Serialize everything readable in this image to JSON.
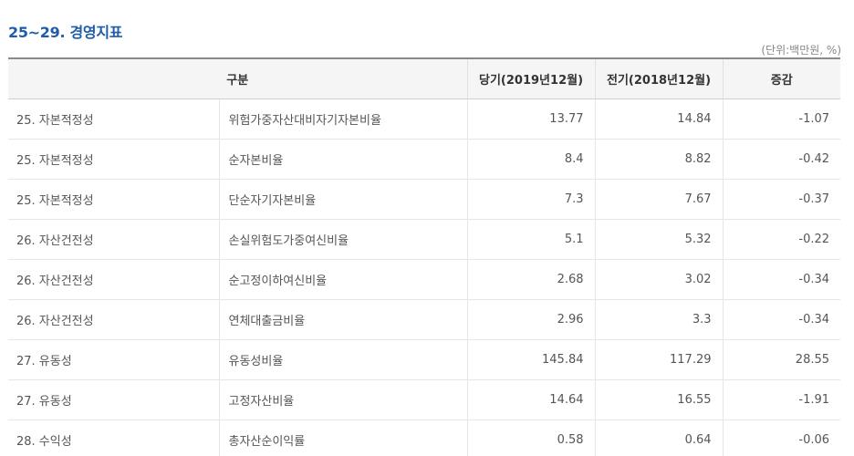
{
  "title": "25~29. 경영지표",
  "unit_note": "(단위:백만원, %)",
  "table": {
    "headers": [
      "구분",
      "당기(2019년12월)",
      "전기(2018년12월)",
      "증감"
    ],
    "rows": [
      {
        "category": "25. 자본적정성",
        "item": "위험가중자산대비자기자본비율",
        "current": "13.77",
        "previous": "14.84",
        "change": "-1.07"
      },
      {
        "category": "25. 자본적정성",
        "item": "순자본비율",
        "current": "8.4",
        "previous": "8.82",
        "change": "-0.42"
      },
      {
        "category": "25. 자본적정성",
        "item": "단순자기자본비율",
        "current": "7.3",
        "previous": "7.67",
        "change": "-0.37"
      },
      {
        "category": "26. 자산건전성",
        "item": "손실위험도가중여신비율",
        "current": "5.1",
        "previous": "5.32",
        "change": "-0.22"
      },
      {
        "category": "26. 자산건전성",
        "item": "순고정이하여신비율",
        "current": "2.68",
        "previous": "3.02",
        "change": "-0.34"
      },
      {
        "category": "26. 자산건전성",
        "item": "연체대출금비율",
        "current": "2.96",
        "previous": "3.3",
        "change": "-0.34"
      },
      {
        "category": "27. 유동성",
        "item": "유동성비율",
        "current": "145.84",
        "previous": "117.29",
        "change": "28.55"
      },
      {
        "category": "27. 유동성",
        "item": "고정자산비율",
        "current": "14.64",
        "previous": "16.55",
        "change": "-1.91"
      },
      {
        "category": "28. 수익성",
        "item": "총자산순이익률",
        "current": "0.58",
        "previous": "0.64",
        "change": "-0.06"
      }
    ]
  }
}
